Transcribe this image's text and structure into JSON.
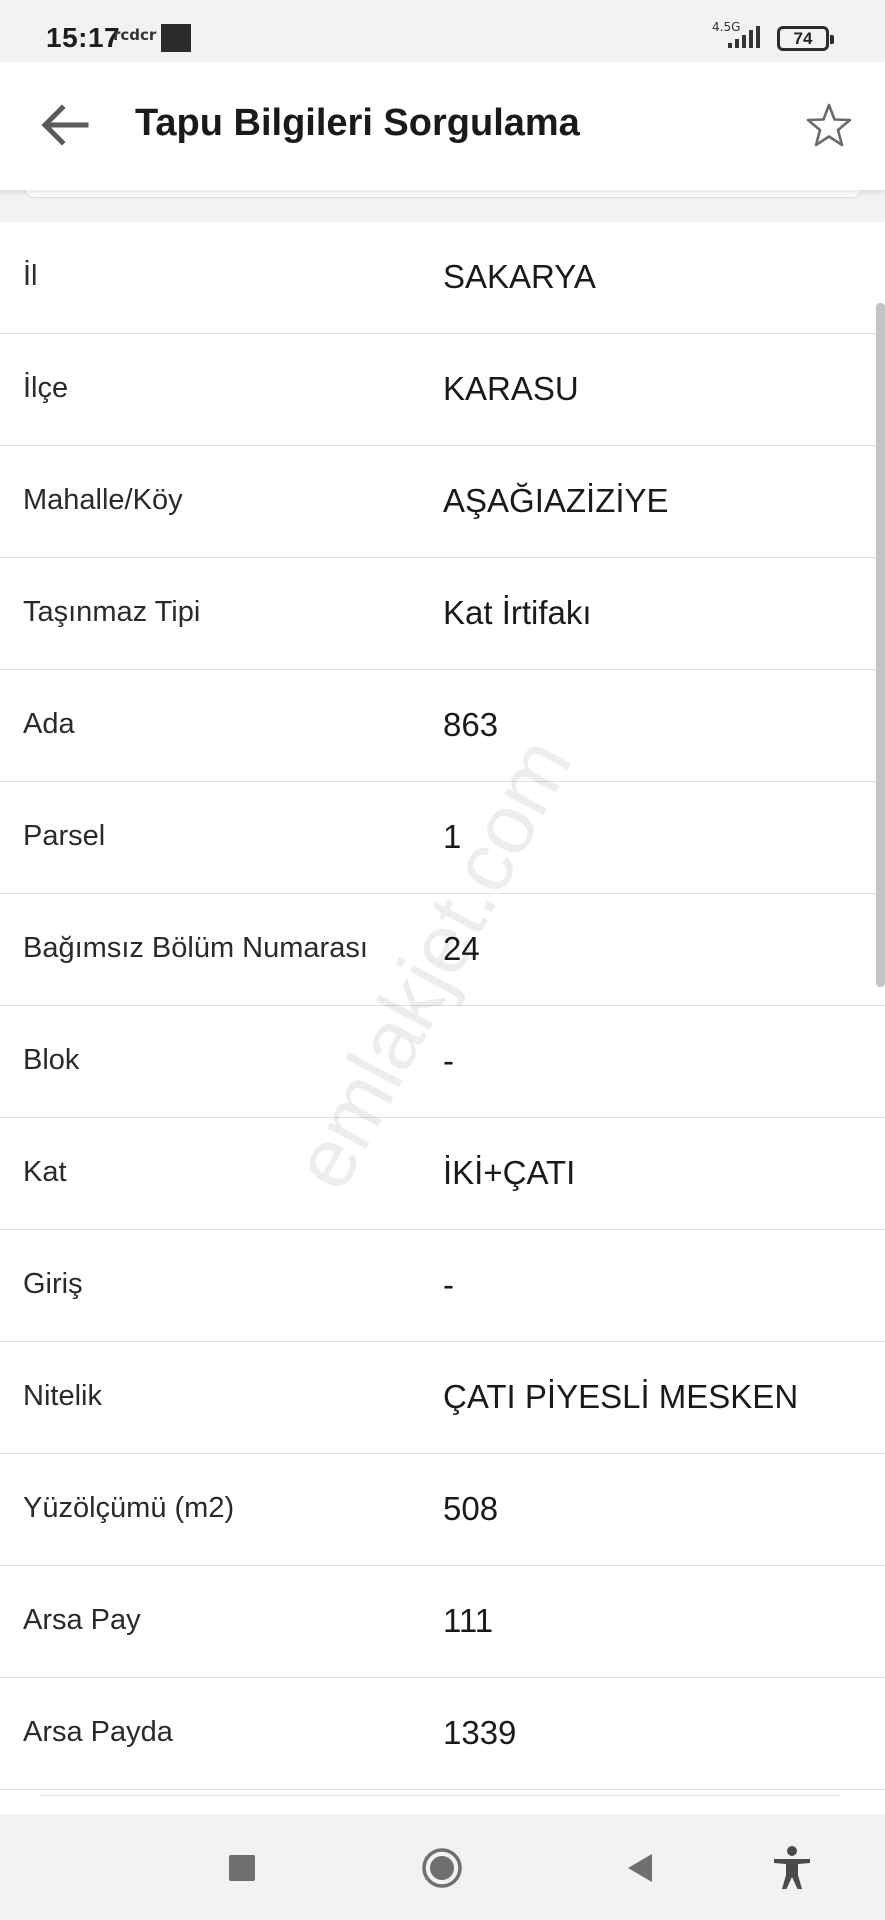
{
  "status_bar": {
    "time": "15:17",
    "app_mark": "rcdcr",
    "network": "4.5G",
    "battery": "74",
    "icons": [
      "app-thumbnail-icon",
      "signal-icon",
      "battery-icon"
    ]
  },
  "app_bar": {
    "title": "Tapu Bilgileri Sorgulama",
    "back_icon": "arrow-left-icon",
    "favorite_icon": "star-outline-icon"
  },
  "rows": [
    {
      "label": "İl",
      "value": "SAKARYA"
    },
    {
      "label": "İlçe",
      "value": "KARASU"
    },
    {
      "label": "Mahalle/Köy",
      "value": "AŞAĞIAZİZİYE"
    },
    {
      "label": "Taşınmaz Tipi",
      "value": "Kat İrtifakı"
    },
    {
      "label": "Ada",
      "value": "863"
    },
    {
      "label": "Parsel",
      "value": "1"
    },
    {
      "label": "Bağımsız Bölüm Numarası",
      "value": "24"
    },
    {
      "label": "Blok",
      "value": "-"
    },
    {
      "label": "Kat",
      "value": "İKİ+ÇATI"
    },
    {
      "label": "Giriş",
      "value": "-"
    },
    {
      "label": "Nitelik",
      "value": "ÇATI PİYESLİ MESKEN"
    },
    {
      "label": "Yüzölçümü (m2)",
      "value": "508"
    },
    {
      "label": "Arsa Pay",
      "value": "111"
    },
    {
      "label": "Arsa Payda",
      "value": "1339"
    }
  ],
  "watermark": "emlakjet.com",
  "nav_bar": {
    "icons": [
      "recents-square-icon",
      "home-circle-icon",
      "back-triangle-icon",
      "accessibility-icon"
    ]
  },
  "colors": {
    "background": "#f2f2f2",
    "surface": "#ffffff",
    "divider": "#dedede",
    "text": "#1a1a1a"
  }
}
